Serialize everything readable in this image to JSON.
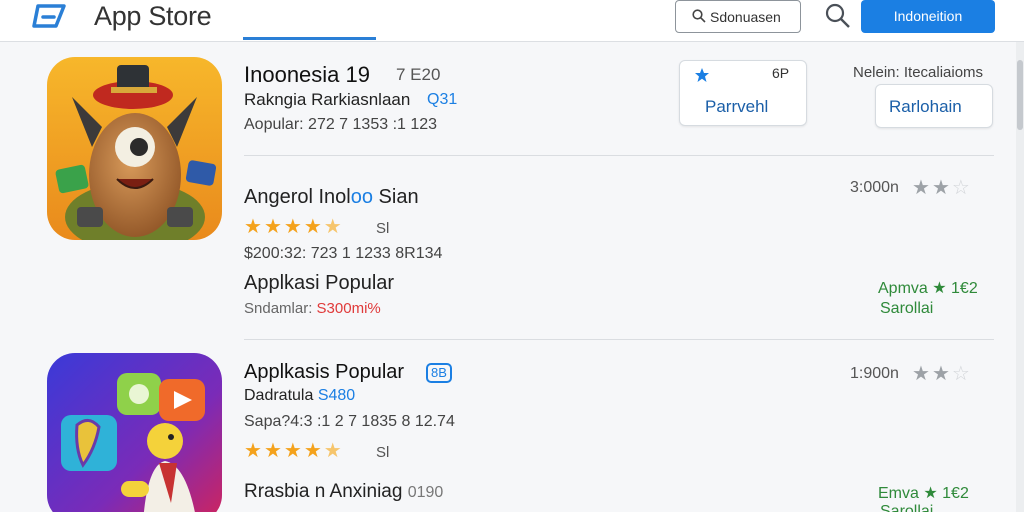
{
  "header": {
    "app_title": "App Store",
    "search_placeholder": "Sdonuasen",
    "primary_button": "Indoneition"
  },
  "featured": {
    "title": "Inoonesia 19",
    "title_suffix": "7 E20",
    "subtitle_1": "Rakngia Rarkiasnlaan",
    "subtitle_1_badge": "Q31",
    "meta": "Aopular: 272 7 1353 :1 123",
    "card_1": {
      "top": "6P",
      "label": "Parrvehl"
    },
    "card_2": {
      "top": "Nelein: Itecaliaioms",
      "label": "Rarlohain"
    }
  },
  "app_1": {
    "title_a": "Angerol Inol",
    "title_b": "oo",
    "title_c": " Sian",
    "rating_count": "3:000n",
    "rating_label": "Sl",
    "price_line": "$200:32: 723 1 1233 8R134",
    "section": "Applkasi Popular",
    "meta_a": "Sndamlar: ",
    "meta_b": "S300mi%",
    "side_line_1": "Apmva",
    "side_line_1_num": "1€2",
    "side_line_2": "Sarollai"
  },
  "app_2": {
    "title": "Applkasis Popular",
    "badge": "8B",
    "rating_count": "1:900n",
    "sub_a": "Dadratula ",
    "sub_b": "S480",
    "meta": "Sapa?4:3 :1 2 7 1835 8 12.74",
    "rating_label": "Sl",
    "section": "Rrasbia n Anxiniag",
    "section_num": "0190",
    "side_line_1": "Emva",
    "side_line_1_num": "1€2",
    "side_line_2": "Sarollai"
  },
  "colors": {
    "accent": "#1b7fe3",
    "star": "#f4a21c",
    "green": "#2f8a3a",
    "red": "#e03a3a"
  },
  "ratings": {
    "app_1_stars": 4.5,
    "app_2_stars": 4.5,
    "app_1_side_stars": 2,
    "app_2_side_stars": 2
  }
}
